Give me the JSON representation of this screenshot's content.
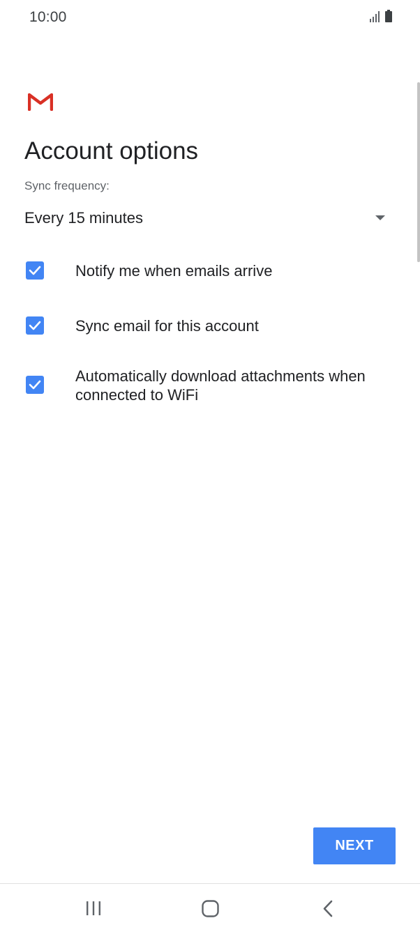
{
  "status_bar": {
    "time": "10:00",
    "icons": [
      "signal-icon",
      "battery-icon"
    ]
  },
  "app": {
    "logo": "gmail-logo",
    "title": "Account options"
  },
  "sync": {
    "label": "Sync frequency:",
    "value": "Every 15 minutes"
  },
  "options": [
    {
      "label": "Notify me when emails arrive",
      "checked": true
    },
    {
      "label": "Sync email for this account",
      "checked": true
    },
    {
      "label": "Automatically download attachments when connected to WiFi",
      "checked": true
    }
  ],
  "actions": {
    "next_label": "NEXT"
  },
  "nav": {
    "items": [
      "recents-icon",
      "home-icon",
      "back-icon"
    ]
  },
  "colors": {
    "accent": "#4285f4",
    "text_primary": "#202124",
    "text_secondary": "#5f6368",
    "gmail_red": "#d93025"
  }
}
